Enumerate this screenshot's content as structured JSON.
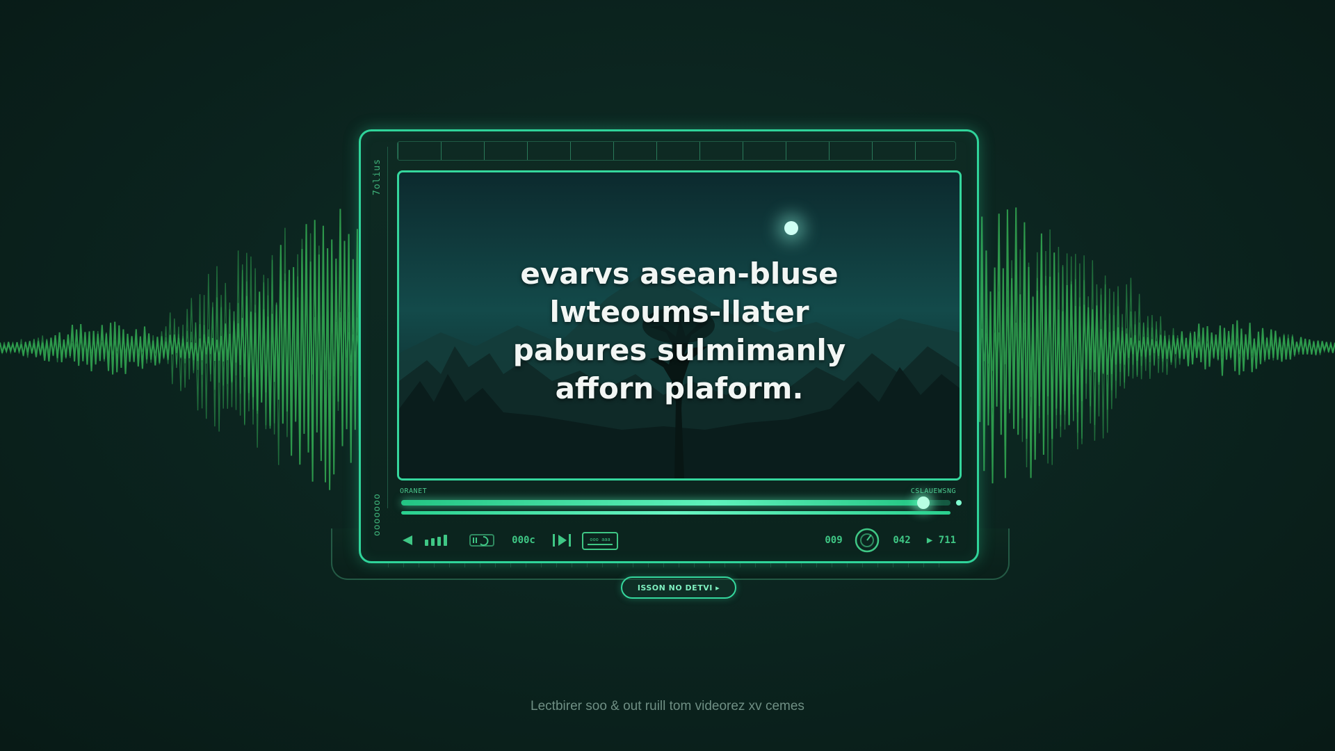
{
  "screen": {
    "overlay_lines": [
      "evarvs asean-bluse",
      "lwteoums-llater",
      "pabures sulmimanly",
      "afforn plaform."
    ]
  },
  "device": {
    "side_label_top": "7olius",
    "side_label_bottom": "ooooooo",
    "time_left": "ORANET",
    "time_right": "CSLAUEWSNG"
  },
  "player": {
    "progress_fraction": 0.95,
    "controls": {
      "counter_left": "000c",
      "counter_right_a": "009",
      "counter_right_b": "042",
      "badge_label": "ooo aaa",
      "end_label": "▶ 711"
    }
  },
  "cta": {
    "label": "ISSON NO DETVI ▸"
  },
  "footer": {
    "caption": "Lectbirer soo & out ruill tom videorez xv cemes"
  },
  "colors": {
    "accent": "#35d79d",
    "wave": "#2f9e4e",
    "background": "#0b231e"
  }
}
